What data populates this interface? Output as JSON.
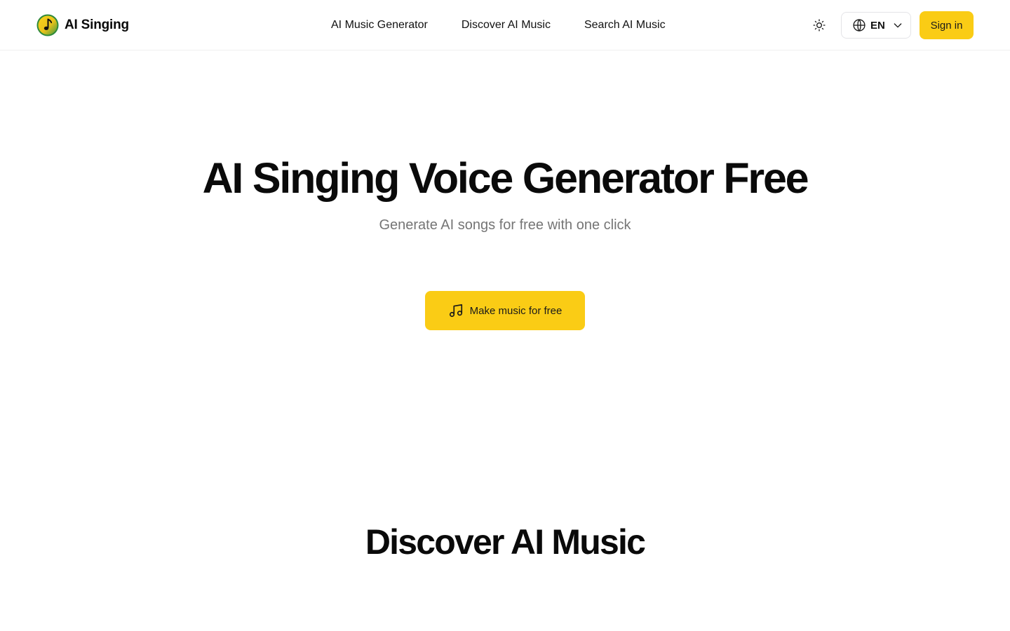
{
  "header": {
    "brand_name": "AI Singing",
    "logo_icon": "music-note-logo-icon",
    "nav": [
      {
        "label": "AI Music Generator"
      },
      {
        "label": "Discover AI Music"
      },
      {
        "label": "Search AI Music"
      }
    ],
    "theme_icon": "sun-icon",
    "language": {
      "code": "EN",
      "icon": "globe-icon",
      "chevron_icon": "chevron-down-icon"
    },
    "signin_label": "Sign in"
  },
  "hero": {
    "title": "AI Singing Voice Generator Free",
    "subtitle": "Generate AI songs for free with one click",
    "cta_label": "Make music for free",
    "cta_icon": "music-note-icon"
  },
  "discover": {
    "title": "Discover AI Music"
  },
  "colors": {
    "accent": "#facc15",
    "logo_outer": "#2f8a3a",
    "logo_inner": "#f5c518",
    "text_primary": "#0a0a0a",
    "text_muted": "#757575",
    "border": "#e4e4e7"
  }
}
